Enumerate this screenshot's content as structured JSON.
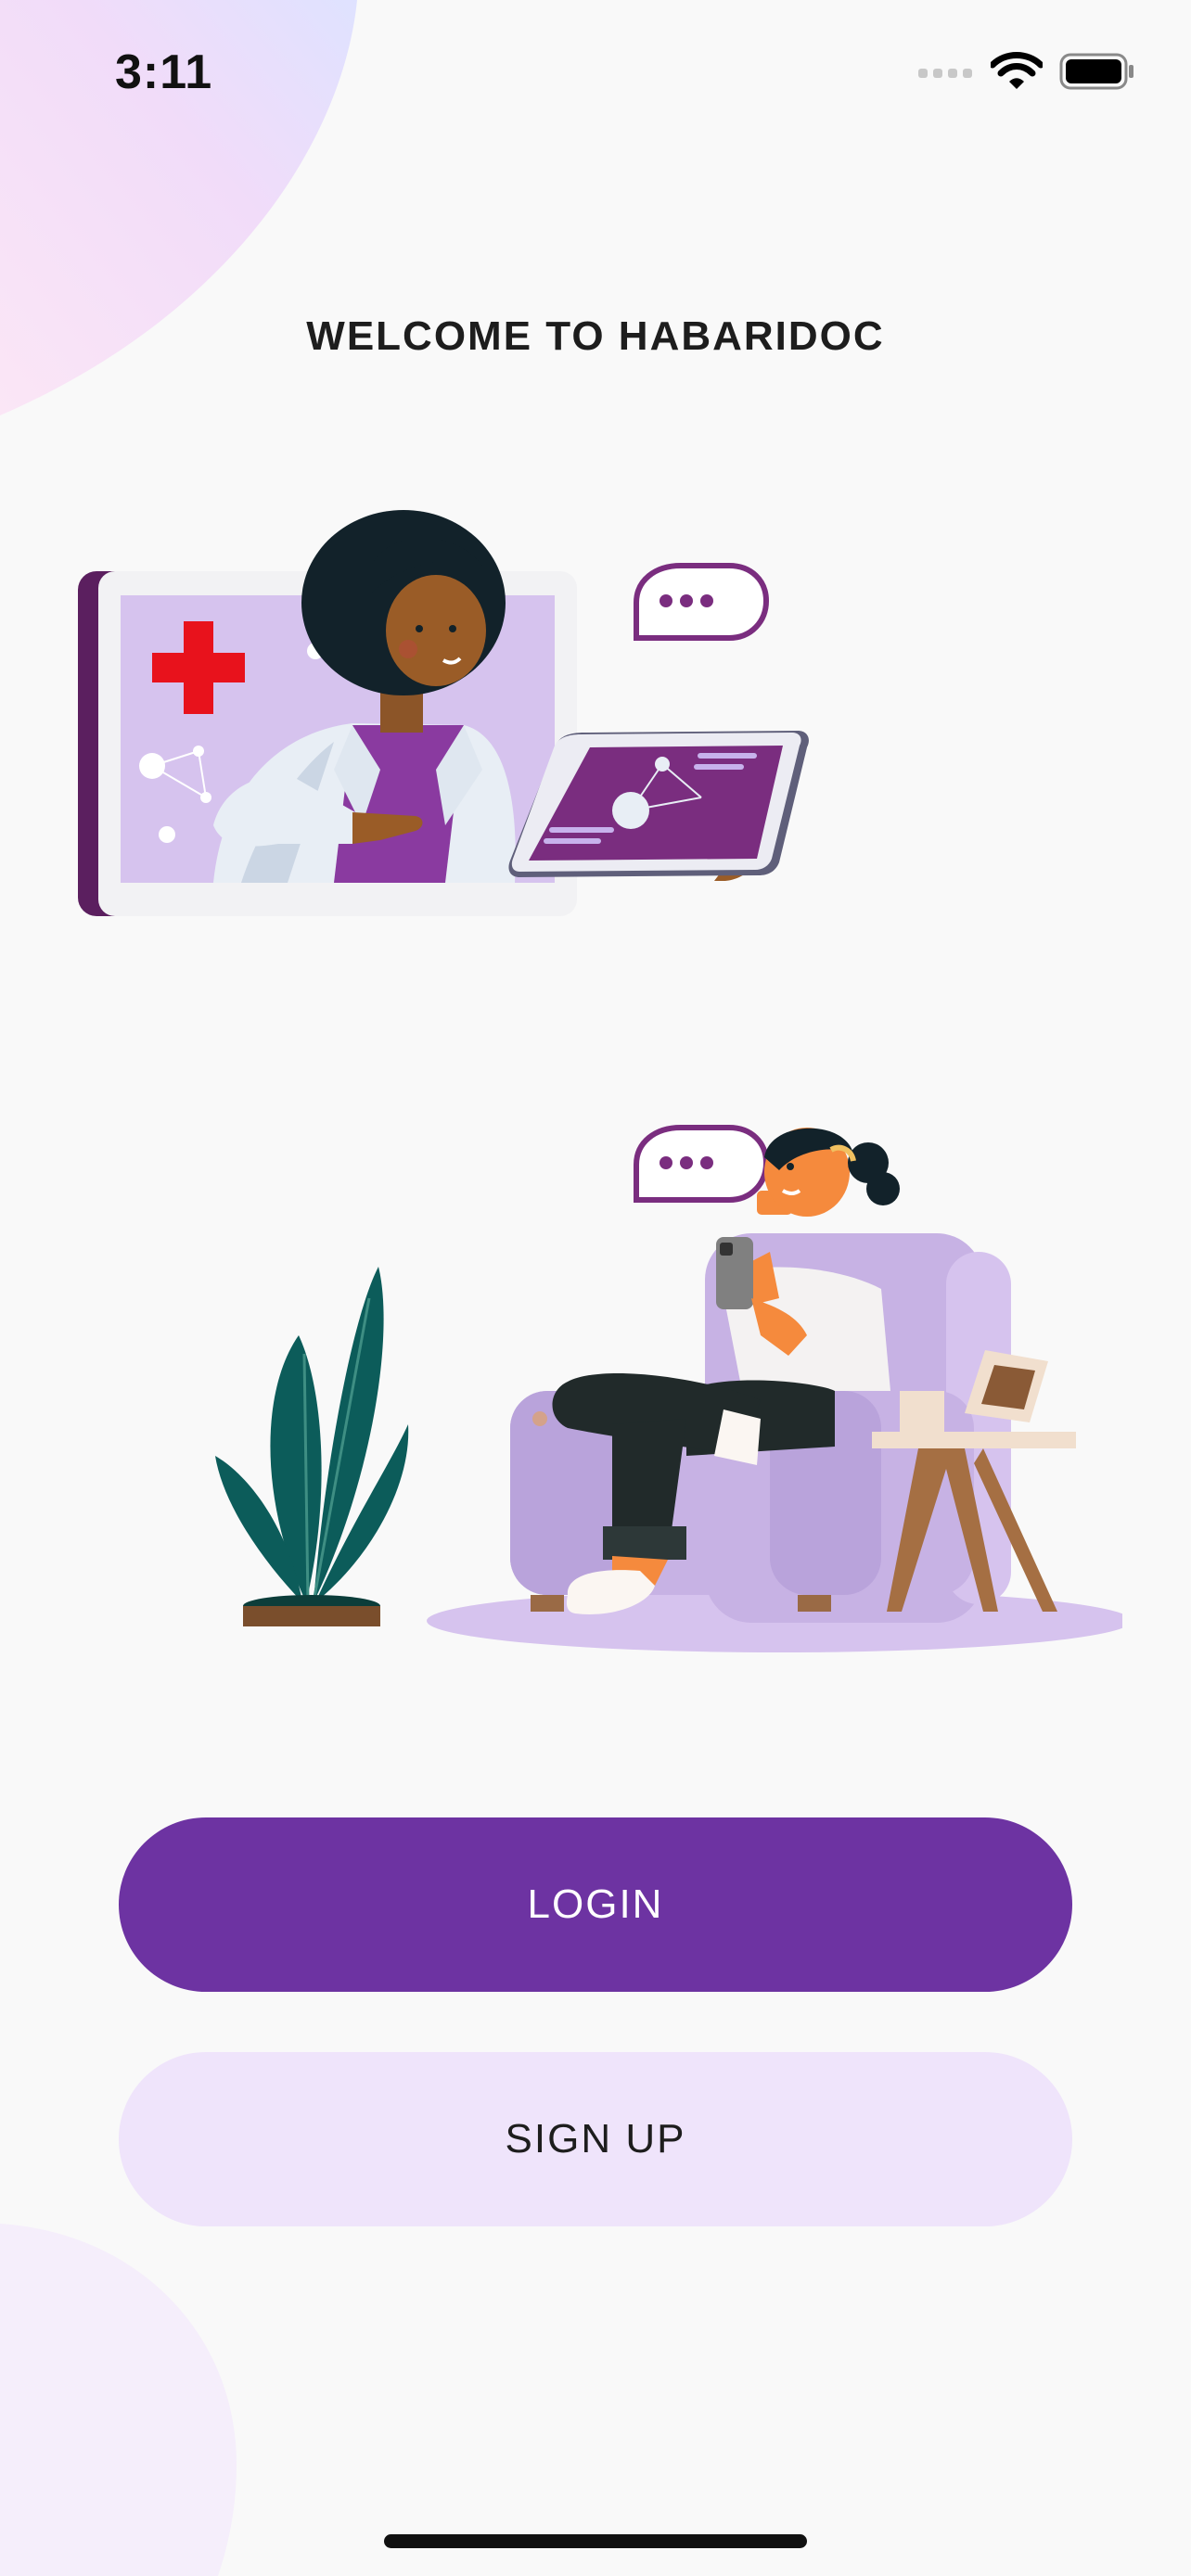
{
  "status_bar": {
    "time": "3:11"
  },
  "welcome": {
    "title": "WELCOME TO HABARIDOC"
  },
  "buttons": {
    "login_label": "LOGIN",
    "signup_label": "SIGN UP"
  },
  "colors": {
    "primary": "#6d33a2",
    "secondary": "#efe4fb",
    "background": "#f9f9f9",
    "accent_lavender": "#d6c3ee"
  },
  "icons": [
    "signal-icon",
    "wifi-icon",
    "battery-icon",
    "chat-bubble-icon",
    "medical-cross-icon"
  ]
}
